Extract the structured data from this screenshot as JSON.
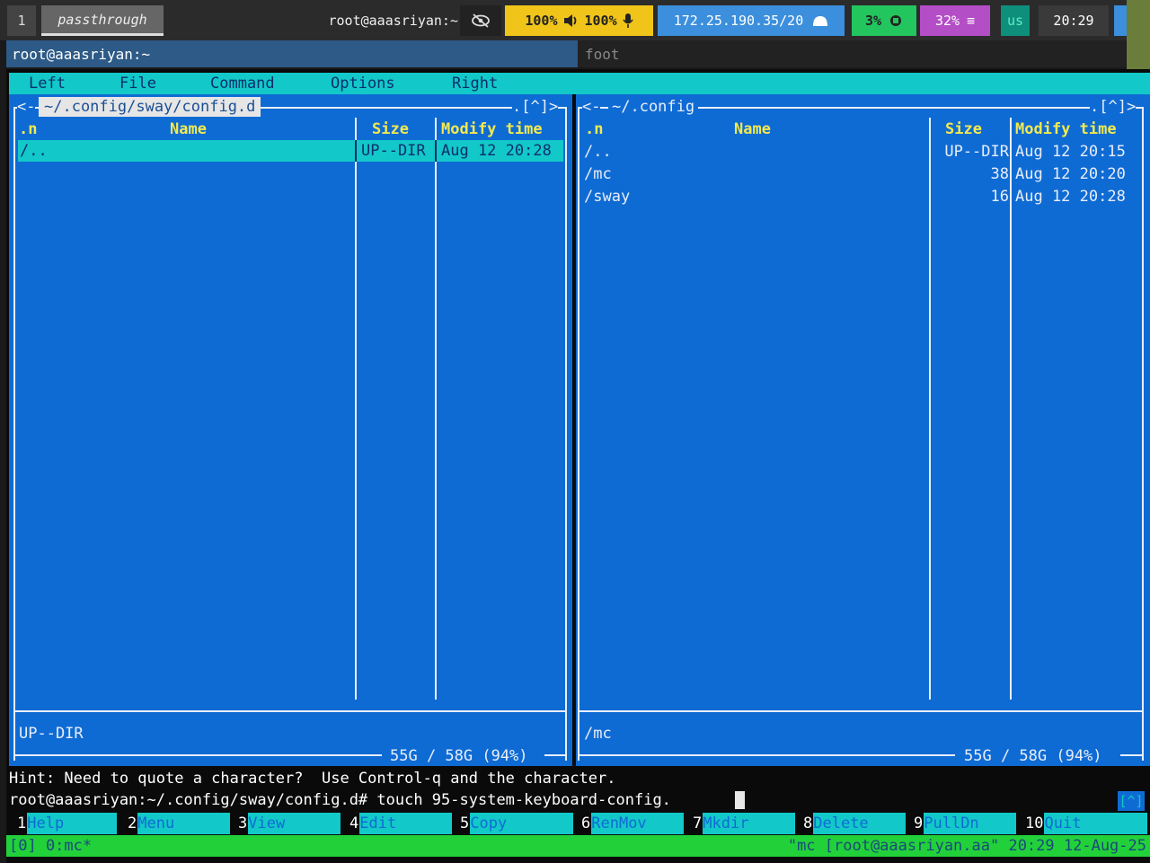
{
  "swaybar": {
    "workspace": "1",
    "mode": "passthrough",
    "window_title": "root@aaasriyan:~",
    "eye_icon": "eye-slash-icon",
    "volume": "100% 🔈 100% 🎙",
    "volume_speaker": "100%",
    "volume_mic": "100%",
    "network": "172.25.190.35/20",
    "cpu": "3%",
    "memory": "32%",
    "keyboard": "us",
    "clock": "20:29",
    "colors": {
      "volume": "#f0c419",
      "network": "#3c8fdc",
      "cpu": "#22c55e",
      "memory": "#b44ec7"
    }
  },
  "windows": {
    "active_title": "root@aaasriyan:~",
    "inactive_title": "foot"
  },
  "mc": {
    "menu": [
      "Left",
      "File",
      "Command",
      "Options",
      "Right"
    ],
    "left_panel": {
      "path": "~/.config/sway/config.d",
      "nav_left": "<-",
      "nav_right": ".[^]>",
      "headers": {
        "sort": ".n",
        "name": "Name",
        "size": "Size",
        "mtime": "Modify time"
      },
      "rows": [
        {
          "name": "/..",
          "size": "UP--DIR",
          "mtime": "Aug 12 20:28",
          "selected": true
        }
      ],
      "status": "UP--DIR",
      "free": "55G / 58G (94%)"
    },
    "right_panel": {
      "path": "~/.config",
      "nav_left": "<-",
      "nav_right": ".[^]>",
      "headers": {
        "sort": ".n",
        "name": "Name",
        "size": "Size",
        "mtime": "Modify time"
      },
      "rows": [
        {
          "name": "/..",
          "size": "UP--DIR",
          "mtime": "Aug 12 20:15"
        },
        {
          "name": "/mc",
          "size": "38",
          "mtime": "Aug 12 20:20"
        },
        {
          "name": "/sway",
          "size": "16",
          "mtime": "Aug 12 20:28"
        }
      ],
      "status": "/mc",
      "free": "55G / 58G (94%)"
    },
    "hint": "Hint: Need to quote a character?  Use Control-q and the character.",
    "command_line": "root@aaasriyan:~/.config/sway/config.d# touch 95-system-keyboard-config.",
    "command_right": "[^]",
    "fkeys": [
      {
        "num": "1",
        "label": "Help"
      },
      {
        "num": "2",
        "label": "Menu"
      },
      {
        "num": "3",
        "label": "View"
      },
      {
        "num": "4",
        "label": "Edit"
      },
      {
        "num": "5",
        "label": "Copy"
      },
      {
        "num": "6",
        "label": "RenMov"
      },
      {
        "num": "7",
        "label": "Mkdir"
      },
      {
        "num": "8",
        "label": "Delete"
      },
      {
        "num": "9",
        "label": "PullDn"
      },
      {
        "num": "10",
        "label": "Quit"
      }
    ]
  },
  "tmux": {
    "left": "[0] 0:mc*",
    "right": "\"mc [root@aaasriyan.aa\" 20:29 12-Aug-25"
  }
}
